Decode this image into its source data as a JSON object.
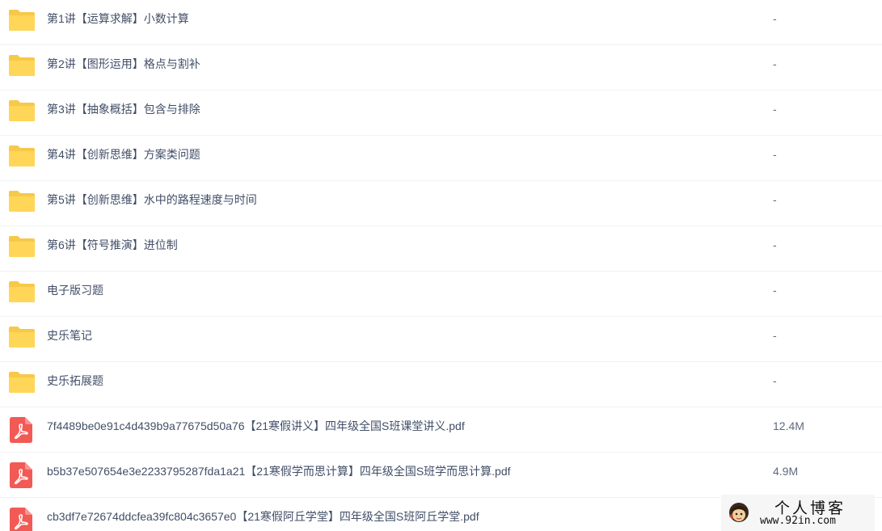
{
  "files": [
    {
      "type": "folder",
      "icon": "folder-icon",
      "name": "第1讲【运算求解】小数计算",
      "size": "-"
    },
    {
      "type": "folder",
      "icon": "folder-icon",
      "name": "第2讲【图形运用】格点与割补",
      "size": "-"
    },
    {
      "type": "folder",
      "icon": "folder-icon",
      "name": "第3讲【抽象概括】包含与排除",
      "size": "-"
    },
    {
      "type": "folder",
      "icon": "folder-icon",
      "name": "第4讲【创新思维】方案类问题",
      "size": "-"
    },
    {
      "type": "folder",
      "icon": "folder-icon",
      "name": "第5讲【创新思维】水中的路程速度与时间",
      "size": "-"
    },
    {
      "type": "folder",
      "icon": "folder-icon",
      "name": "第6讲【符号推演】进位制",
      "size": "-"
    },
    {
      "type": "folder",
      "icon": "folder-icon",
      "name": "电子版习题",
      "size": "-"
    },
    {
      "type": "folder",
      "icon": "folder-icon",
      "name": "史乐笔记",
      "size": "-"
    },
    {
      "type": "folder",
      "icon": "folder-icon",
      "name": "史乐拓展题",
      "size": "-"
    },
    {
      "type": "pdf",
      "icon": "pdf-icon",
      "name": "7f4489be0e91c4d439b9a77675d50a76【21寒假讲义】四年级全国S班课堂讲义.pdf",
      "size": "12.4M"
    },
    {
      "type": "pdf",
      "icon": "pdf-icon",
      "name": "b5b37e507654e3e2233795287fda1a21【21寒假学而思计算】四年级全国S班学而思计算.pdf",
      "size": "4.9M"
    },
    {
      "type": "pdf",
      "icon": "pdf-icon",
      "name": "cb3df7e72674ddcfea39fc804c3657e0【21寒假阿丘学堂】四年级全国S班阿丘学堂.pdf",
      "size": ""
    }
  ],
  "watermark": {
    "title": "个人博客",
    "url": "www.92in.com"
  },
  "colors": {
    "folder": "#ffd658",
    "folder_tab": "#f7c948",
    "pdf": "#f25a55",
    "text": "#424e67",
    "divider": "#f1f2f4"
  }
}
